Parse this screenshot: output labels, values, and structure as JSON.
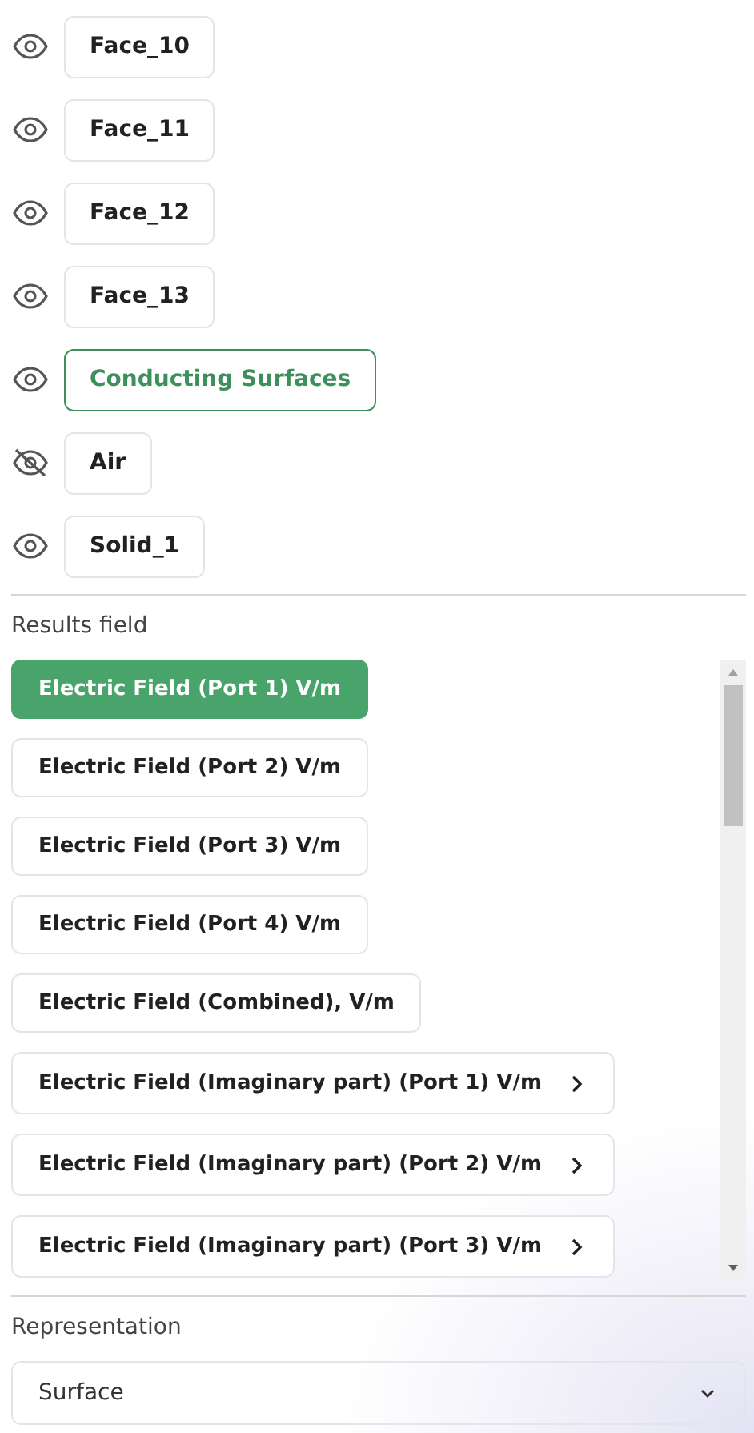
{
  "layers": [
    {
      "name": "Face_10",
      "visible": true,
      "selected": false
    },
    {
      "name": "Face_11",
      "visible": true,
      "selected": false
    },
    {
      "name": "Face_12",
      "visible": true,
      "selected": false
    },
    {
      "name": "Face_13",
      "visible": true,
      "selected": false
    },
    {
      "name": "Conducting Surfaces",
      "visible": true,
      "selected": true
    },
    {
      "name": "Air",
      "visible": false,
      "selected": false
    },
    {
      "name": "Solid_1",
      "visible": true,
      "selected": false
    }
  ],
  "results_field": {
    "label": "Results field",
    "items": [
      {
        "label": "Electric Field (Port 1) V/m",
        "selected": true,
        "kind": "plain"
      },
      {
        "label": "Electric Field (Port 2) V/m",
        "selected": false,
        "kind": "plain"
      },
      {
        "label": "Electric Field (Port 3) V/m",
        "selected": false,
        "kind": "plain"
      },
      {
        "label": "Electric Field (Port 4) V/m",
        "selected": false,
        "kind": "plain"
      },
      {
        "label": "Electric Field (Combined), V/m",
        "selected": false,
        "kind": "plain"
      },
      {
        "label": "Electric Field (Imaginary part) (Port 1) V/m",
        "selected": false,
        "kind": "submenu"
      },
      {
        "label": "Electric Field (Imaginary part) (Port 2) V/m",
        "selected": false,
        "kind": "submenu"
      },
      {
        "label": "Electric Field (Imaginary part) (Port 3) V/m",
        "selected": false,
        "kind": "submenu"
      }
    ]
  },
  "representation": {
    "label": "Representation",
    "value": "Surface"
  }
}
